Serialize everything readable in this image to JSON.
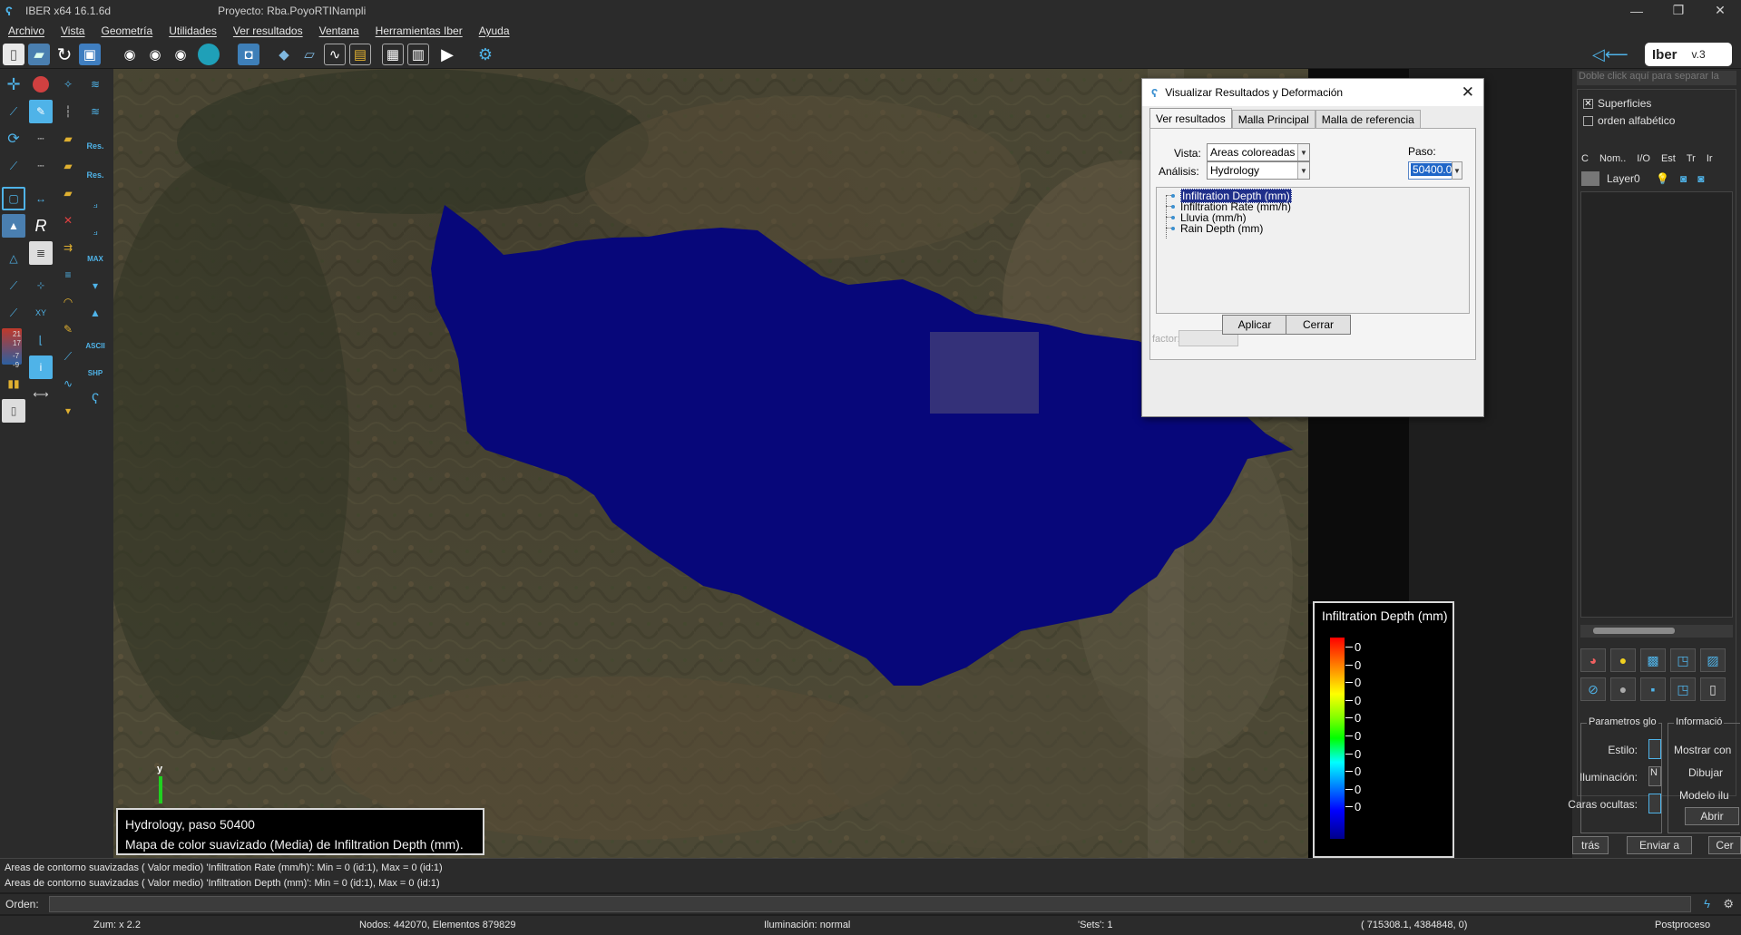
{
  "titlebar": {
    "app_title": "IBER x64 16.1.6d",
    "project": "Proyecto: Rba.PoyoRTINampli",
    "minimize": "—",
    "maximize": "❐",
    "close": "✕"
  },
  "menu": [
    "Archivo",
    "Vista",
    "Geometría",
    "Utilidades",
    "Ver resultados",
    "Ventana",
    "Herramientas Iber",
    "Ayuda"
  ],
  "toolbar": {
    "brand": "Iber",
    "version": "v.3"
  },
  "left_tools": {
    "res_label": "Res.",
    "res2_label": "Res.",
    "max_label": "MAX",
    "ascii_label": "ASCII",
    "shp_label": "SHP",
    "xy_label": "XY",
    "num_21": "21",
    "num_17": "17",
    "num_m7": "-7",
    "num_m9": "-9"
  },
  "caption": {
    "line1": "Hydrology, paso 50400",
    "line2": "Mapa de color suavizado (Media) de Infiltration Depth (mm)."
  },
  "axis": {
    "y_label": "y"
  },
  "legend": {
    "title": "Infiltration Depth (mm)",
    "values": [
      "0",
      "0",
      "0",
      "0",
      "0",
      "0",
      "0",
      "0",
      "0",
      "0"
    ],
    "colors": [
      "#ff0000",
      "#ff8000",
      "#ffff00",
      "#00ff00",
      "#00ffff",
      "#0080ff",
      "#0000ff",
      "#00008b"
    ]
  },
  "dialog": {
    "title": "Visualizar Resultados y Deformación",
    "close": "✕",
    "tabs": [
      "Ver resultados",
      "Malla Principal",
      "Malla de referencia"
    ],
    "vista_label": "Vista:",
    "vista_value": "Areas coloreadas suave",
    "analisis_label": "Análisis:",
    "analisis_value": "Hydrology",
    "paso_label": "Paso:",
    "paso_value": "50400.0",
    "results": [
      "Infiltration Depth (mm)",
      "Infiltration Rate (mm/h)",
      "Lluvia (mm/h)",
      "Rain Depth (mm)"
    ],
    "factor_label": "factor:",
    "apply": "Aplicar",
    "close_btn": "Cerrar"
  },
  "right_panel": {
    "hint": "Doble click aquí para separar la",
    "surfaces": "Superficies",
    "alpha": "orden alfabético",
    "columns": [
      "C",
      "Nom..",
      "I/O",
      "Est",
      "Tr",
      "Ir"
    ],
    "layer_name": "Layer0",
    "params_title": "Parametros glo",
    "info_title": "Informació",
    "estilo": "Estilo:",
    "iluminacion": "Iluminación:",
    "iluminacion_val": "N",
    "caras": "Caras ocultas:",
    "mostrar": "Mostrar con",
    "dibujar": "Dibujar",
    "modelo": "Modelo ilu",
    "abrir": "Abrir",
    "btn_tras": "trás",
    "btn_enviar": "Enviar a",
    "btn_cer": "Cer"
  },
  "cmdlog": {
    "line1": "Areas de contorno suavizadas ( Valor medio) 'Infiltration Rate (mm/h)': Min = 0 (id:1), Max = 0 (id:1)",
    "line2": "Areas de contorno suavizadas ( Valor medio) 'Infiltration Depth (mm)': Min = 0 (id:1), Max = 0 (id:1)"
  },
  "cmdline": {
    "label": "Orden:"
  },
  "status": {
    "zoom": "Zum: x 2.2",
    "nodes": "Nodos: 442070, Elementos 879829",
    "light": "Iluminación: normal",
    "sets": "'Sets': 1",
    "coords": "( 715308.1,  4384848,  0)",
    "mode": "Postproceso"
  }
}
